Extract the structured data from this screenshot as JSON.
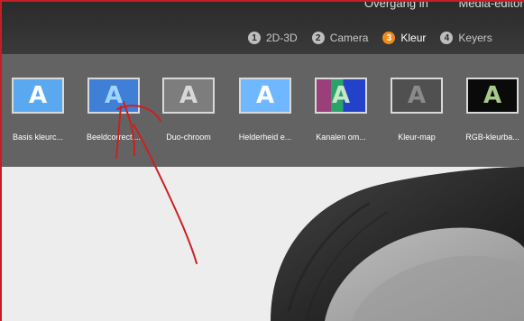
{
  "top_menu": [
    "Overgang in",
    "Media-editor"
  ],
  "tabs": [
    {
      "num": "1",
      "label": "2D-3D",
      "active": false
    },
    {
      "num": "2",
      "label": "Camera",
      "active": false
    },
    {
      "num": "3",
      "label": "Kleur",
      "active": true
    },
    {
      "num": "4",
      "label": "Keyers",
      "active": false
    }
  ],
  "effects": [
    {
      "glyph": "A",
      "label": "Basis kleurc...",
      "bg": "#5aa9f0",
      "glyph_color": "#ffffff"
    },
    {
      "glyph": "A",
      "label": "Beeldcorrecti...",
      "bg": "#3f7fd6",
      "glyph_color": "#9fd4ff"
    },
    {
      "glyph": "A",
      "label": "Duo-chroom",
      "bg": "#7d7d7d",
      "glyph_color": "#d8d8d8"
    },
    {
      "glyph": "A",
      "label": "Helderheid e...",
      "bg": "#6fb8ff",
      "glyph_color": "#ffffff"
    },
    {
      "glyph": "A",
      "label": "Kanalen om...",
      "bg": "multi",
      "glyph_color": "#c6e8c6"
    },
    {
      "glyph": "A",
      "label": "Kleur-map",
      "bg": "#505050",
      "glyph_color": "#8a8a8a"
    },
    {
      "glyph": "A",
      "label": "RGB-kleurba...",
      "bg": "#0a0a0a",
      "glyph_color": "#a9c98a"
    }
  ],
  "colors": {
    "active_tab": "#f08a1c",
    "annotation": "#cc2020"
  }
}
